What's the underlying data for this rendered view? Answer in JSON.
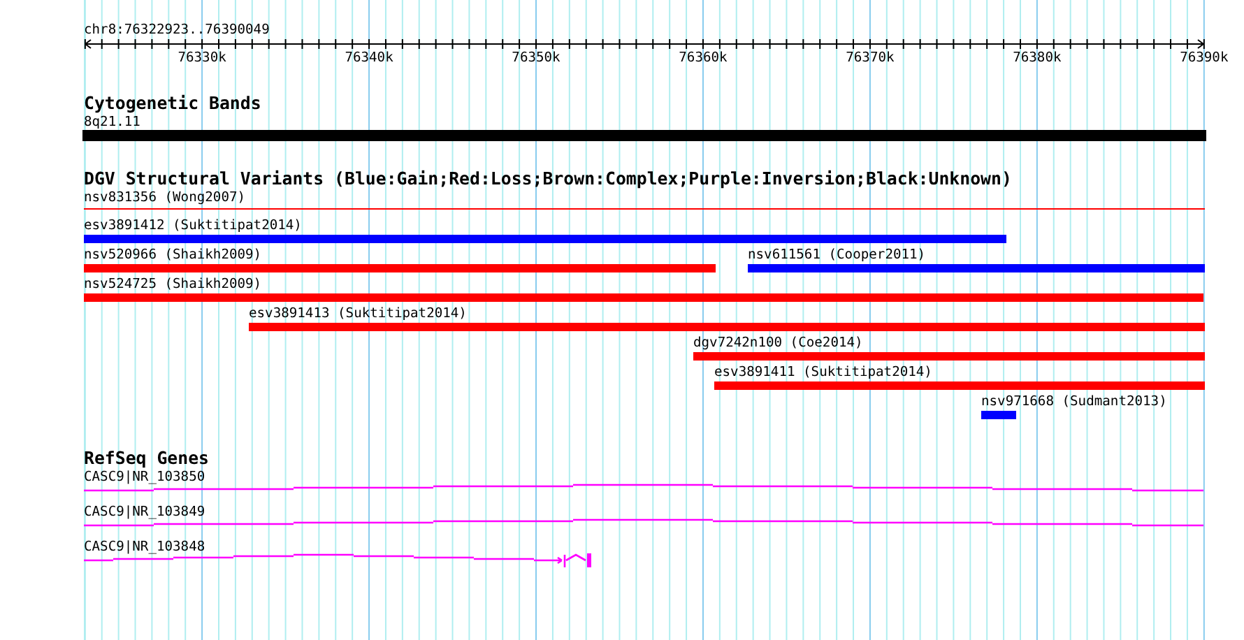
{
  "ruler": {
    "location": "chr8:76322923..76390049",
    "ticks": [
      "76330k",
      "76340k",
      "76350k",
      "76360k",
      "76370k",
      "76380k",
      "76390k"
    ]
  },
  "cytogenetic_bands": {
    "title": "Cytogenetic Bands",
    "bands": [
      {
        "label": "8q21.11",
        "color": "#000000"
      }
    ]
  },
  "variants": {
    "title": "DGV Structural Variants (Blue:Gain;Red:Loss;Brown:Complex;Purple:Inversion;Black:Unknown)",
    "items": [
      {
        "label": "nsv831356 (Wong2007)",
        "color": "#ff0000"
      },
      {
        "label": "esv3891412 (Suktitipat2014)",
        "color": "#0000ff"
      },
      {
        "label": "nsv520966 (Shaikh2009)",
        "color": "#ff0000"
      },
      {
        "label": "nsv611561 (Cooper2011)",
        "color": "#0000ff"
      },
      {
        "label": "nsv524725 (Shaikh2009)",
        "color": "#ff0000"
      },
      {
        "label": "esv3891413 (Suktitipat2014)",
        "color": "#ff0000"
      },
      {
        "label": "dgv7242n100 (Coe2014)",
        "color": "#ff0000"
      },
      {
        "label": "esv3891411 (Suktitipat2014)",
        "color": "#ff0000"
      },
      {
        "label": "nsv971668 (Sudmant2013)",
        "color": "#0000ff"
      }
    ]
  },
  "refseq_genes": {
    "title": "RefSeq Genes",
    "genes": [
      {
        "label": "CASC9|NR_103850"
      },
      {
        "label": "CASC9|NR_103849"
      },
      {
        "label": "CASC9|NR_103848"
      }
    ]
  }
}
